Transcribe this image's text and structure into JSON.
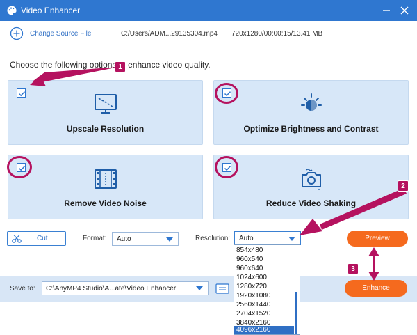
{
  "window": {
    "title": "Video Enhancer",
    "minimize_icon": "minimize-icon",
    "close_icon": "close-icon"
  },
  "file": {
    "change_source_label": "Change Source File",
    "path": "C:/Users/ADM...29135304.mp4",
    "meta": "720x1280/00:00:15/13.41 MB"
  },
  "prompt": "Choose the following options to enhance video quality.",
  "options": [
    {
      "label": "Upscale Resolution",
      "checked": true,
      "icon": "monitor-resolution-icon"
    },
    {
      "label": "Optimize Brightness and Contrast",
      "checked": true,
      "icon": "brightness-icon"
    },
    {
      "label": "Remove Video Noise",
      "checked": true,
      "icon": "film-strip-icon"
    },
    {
      "label": "Reduce Video Shaking",
      "checked": true,
      "icon": "camera-stabilize-icon"
    }
  ],
  "controls": {
    "cut_label": "Cut",
    "format_label": "Format:",
    "format_value": "Auto",
    "resolution_label": "Resolution:",
    "resolution_value": "Auto",
    "preview_label": "Preview",
    "enhance_label": "Enhance"
  },
  "resolution_options": [
    "854x480",
    "960x540",
    "960x640",
    "1024x600",
    "1280x720",
    "1920x1080",
    "2560x1440",
    "2704x1520",
    "3840x2160",
    "4096x2160"
  ],
  "resolution_selected": "4096x2160",
  "save": {
    "label": "Save to:",
    "path": "C:\\AnyMP4 Studio\\A...ate\\Video Enhancer"
  },
  "badges": [
    "1",
    "2",
    "3"
  ],
  "colors": {
    "accent": "#2f77d0",
    "orange": "#f56a1e",
    "annotation": "#b5125f",
    "card": "#d7e7f8"
  }
}
